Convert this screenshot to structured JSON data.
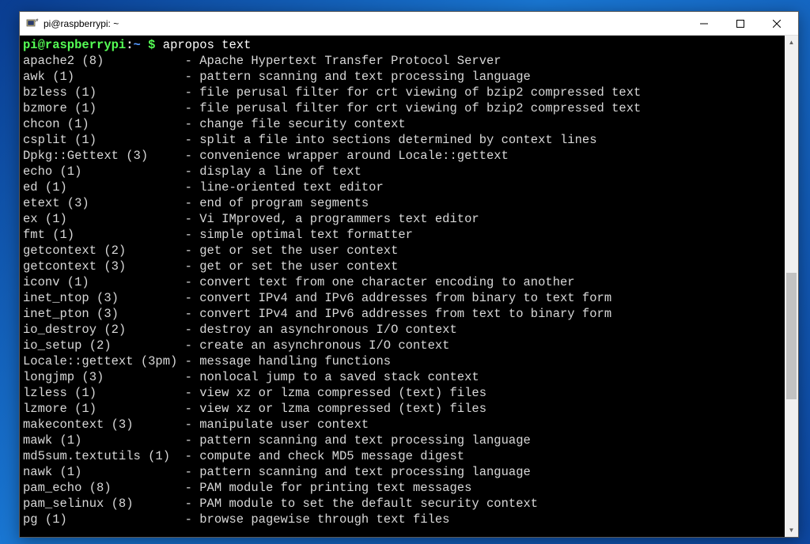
{
  "window": {
    "title": "pi@raspberrypi: ~"
  },
  "prompt": {
    "userhost": "pi@raspberrypi",
    "sep": ":",
    "path": "~",
    "dollar": " $ ",
    "command": "apropos text"
  },
  "entries": [
    {
      "name": "apache2 (8)",
      "desc": "Apache Hypertext Transfer Protocol Server"
    },
    {
      "name": "awk (1)",
      "desc": "pattern scanning and text processing language"
    },
    {
      "name": "bzless (1)",
      "desc": "file perusal filter for crt viewing of bzip2 compressed text"
    },
    {
      "name": "bzmore (1)",
      "desc": "file perusal filter for crt viewing of bzip2 compressed text"
    },
    {
      "name": "chcon (1)",
      "desc": "change file security context"
    },
    {
      "name": "csplit (1)",
      "desc": "split a file into sections determined by context lines"
    },
    {
      "name": "Dpkg::Gettext (3)",
      "desc": "convenience wrapper around Locale::gettext"
    },
    {
      "name": "echo (1)",
      "desc": "display a line of text"
    },
    {
      "name": "ed (1)",
      "desc": "line-oriented text editor"
    },
    {
      "name": "etext (3)",
      "desc": "end of program segments"
    },
    {
      "name": "ex (1)",
      "desc": "Vi IMproved, a programmers text editor"
    },
    {
      "name": "fmt (1)",
      "desc": "simple optimal text formatter"
    },
    {
      "name": "getcontext (2)",
      "desc": "get or set the user context"
    },
    {
      "name": "getcontext (3)",
      "desc": "get or set the user context"
    },
    {
      "name": "iconv (1)",
      "desc": "convert text from one character encoding to another"
    },
    {
      "name": "inet_ntop (3)",
      "desc": "convert IPv4 and IPv6 addresses from binary to text form"
    },
    {
      "name": "inet_pton (3)",
      "desc": "convert IPv4 and IPv6 addresses from text to binary form"
    },
    {
      "name": "io_destroy (2)",
      "desc": "destroy an asynchronous I/O context"
    },
    {
      "name": "io_setup (2)",
      "desc": "create an asynchronous I/O context"
    },
    {
      "name": "Locale::gettext (3pm)",
      "desc": "message handling functions"
    },
    {
      "name": "longjmp (3)",
      "desc": "nonlocal jump to a saved stack context"
    },
    {
      "name": "lzless (1)",
      "desc": "view xz or lzma compressed (text) files"
    },
    {
      "name": "lzmore (1)",
      "desc": "view xz or lzma compressed (text) files"
    },
    {
      "name": "makecontext (3)",
      "desc": "manipulate user context"
    },
    {
      "name": "mawk (1)",
      "desc": "pattern scanning and text processing language"
    },
    {
      "name": "md5sum.textutils (1)",
      "desc": "compute and check MD5 message digest"
    },
    {
      "name": "nawk (1)",
      "desc": "pattern scanning and text processing language"
    },
    {
      "name": "pam_echo (8)",
      "desc": "PAM module for printing text messages"
    },
    {
      "name": "pam_selinux (8)",
      "desc": "PAM module to set the default security context"
    },
    {
      "name": "pg (1)",
      "desc": "browse pagewise through text files"
    }
  ],
  "layout": {
    "name_col_width": 22
  }
}
